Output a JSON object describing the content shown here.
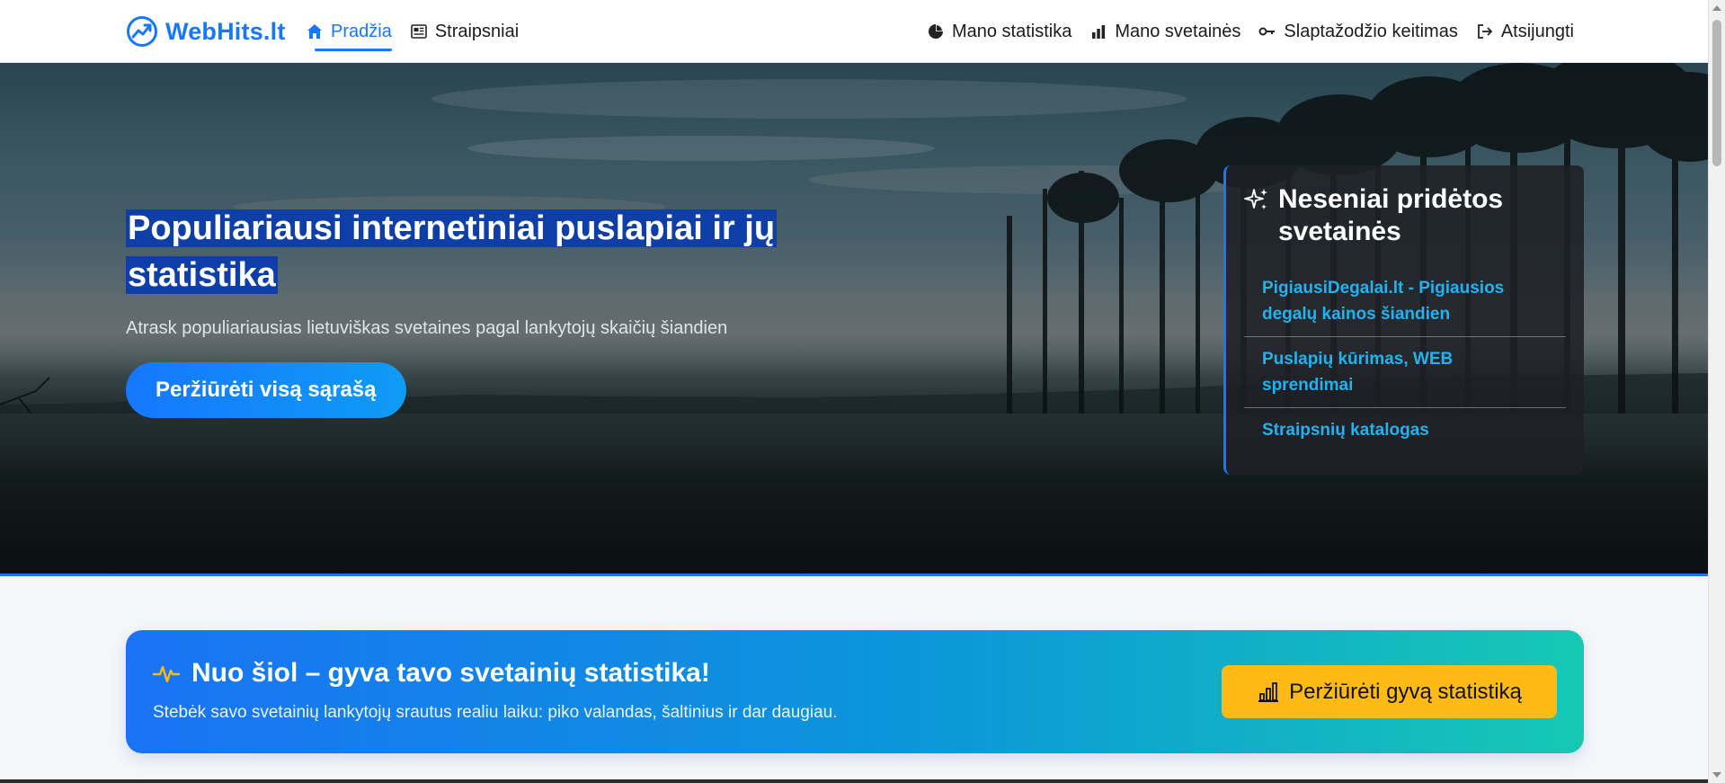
{
  "brand": {
    "name": "WebHits.lt",
    "color": "#1677ff"
  },
  "nav": {
    "left": [
      {
        "label": "Pradžia",
        "icon": "home-icon",
        "active": true
      },
      {
        "label": "Straipsniai",
        "icon": "newspaper-icon",
        "active": false
      }
    ],
    "right": [
      {
        "label": "Mano statistika",
        "icon": "pie-chart-icon"
      },
      {
        "label": "Mano svetainės",
        "icon": "bar-chart-icon"
      },
      {
        "label": "Slaptažodžio keitimas",
        "icon": "key-icon"
      },
      {
        "label": "Atsijungti",
        "icon": "logout-icon"
      }
    ]
  },
  "hero": {
    "title": "Populiariausi internetiniai puslapiai ir jų statistika",
    "subtitle": "Atrask populiariausias lietuviškas svetaines pagal lankytojų skaičių šiandien",
    "button_label": "Peržiūrėti visą sąrašą"
  },
  "recent": {
    "title": "Neseniai pridėtos svetainės",
    "icon": "sparkles-icon",
    "items": [
      "PigiausiDegalai.lt - Pigiausios degalų kainos šiandien",
      "Puslapių kūrimas, WEB sprendimai",
      "Straipsnių katalogas"
    ]
  },
  "promo": {
    "title": "Nuo šiol – gyva tavo svetainių statistika!",
    "icon": "activity-icon",
    "subtitle": "Stebėk savo svetainių lankytojų srautus realiu laiku: piko valandas, šaltinius ir dar daugiau.",
    "button_label": "Peržiūrėti gyvą statistiką",
    "button_icon": "bar-chart-icon",
    "colors": {
      "accent": "#ffbb14",
      "gradient_start": "#1a73f5",
      "gradient_end": "#16c9b4"
    }
  }
}
